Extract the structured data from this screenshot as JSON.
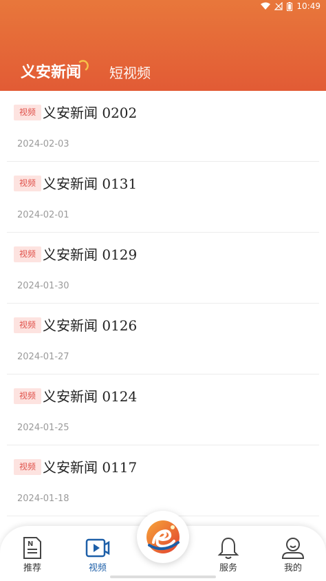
{
  "status_bar": {
    "time": "10:49"
  },
  "tabs": [
    {
      "label": "义安新闻",
      "active": true
    },
    {
      "label": "短视频",
      "active": false
    }
  ],
  "news_items": [
    {
      "badge": "视频",
      "title": "义安新闻 0202",
      "date": "2024-02-03"
    },
    {
      "badge": "视频",
      "title": "义安新闻 0131",
      "date": "2024-02-01"
    },
    {
      "badge": "视频",
      "title": "义安新闻 0129",
      "date": "2024-01-30"
    },
    {
      "badge": "视频",
      "title": "义安新闻 0126",
      "date": "2024-01-27"
    },
    {
      "badge": "视频",
      "title": "义安新闻 0124",
      "date": "2024-01-25"
    },
    {
      "badge": "视频",
      "title": "义安新闻 0117",
      "date": "2024-01-18"
    }
  ],
  "bottom_nav": [
    {
      "label": "推荐",
      "icon": "news-icon"
    },
    {
      "label": "视频",
      "icon": "video-icon",
      "active": true
    },
    {
      "label": "服务",
      "icon": "bell-icon"
    },
    {
      "label": "我的",
      "icon": "user-icon"
    }
  ],
  "colors": {
    "header": "#e25b35",
    "accent_blue": "#1d5fa8",
    "badge_text": "#e0514a",
    "badge_bg": "#fde3e0"
  }
}
